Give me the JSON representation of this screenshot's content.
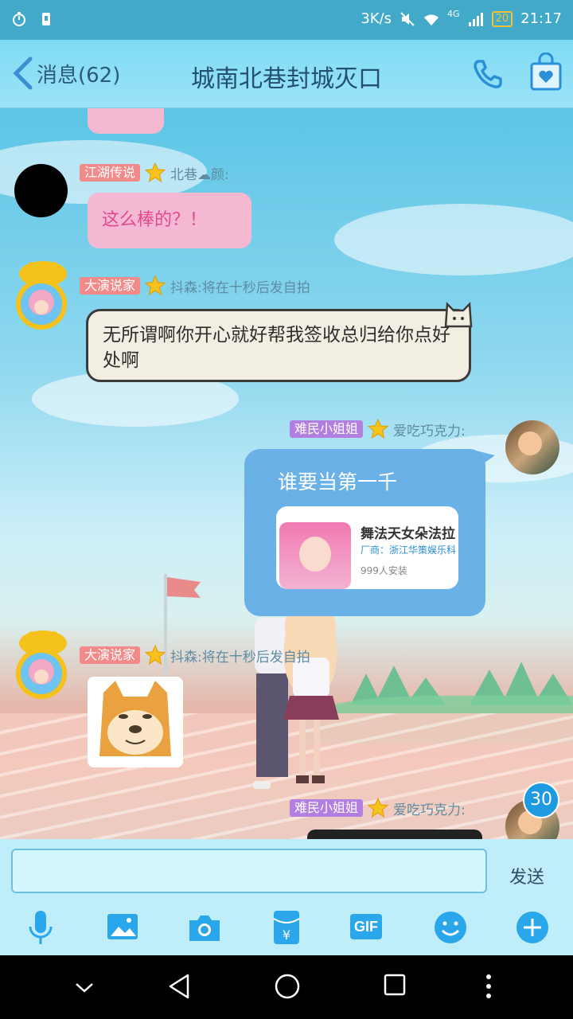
{
  "status_bar": {
    "speed": "3K/s",
    "network": "4G",
    "battery": "20",
    "time": "21:17"
  },
  "header": {
    "back_label": "消息(62)",
    "title": "城南北巷封城灭口"
  },
  "messages": [
    {
      "badge": "江湖传说",
      "badge_color": "#f28a8a",
      "sender": "北巷☁颜:",
      "text": "这么棒的？！"
    },
    {
      "badge": "大演说家",
      "badge_color": "#f28a8a",
      "sender": "抖森:将在十秒后发自拍",
      "text": "无所谓啊你开心就好帮我签收总归给你点好处啊"
    },
    {
      "badge": "难民小姐姐",
      "badge_color": "#b27fe0",
      "sender": "爱吃巧克力:",
      "text": "谁要当第一千",
      "card": {
        "title": "舞法天女朵法拉",
        "vendor": "厂商：浙江华策娱乐科",
        "installs": "999人安装"
      }
    },
    {
      "badge": "大演说家",
      "badge_color": "#f28a8a",
      "sender": "抖森:将在十秒后发自拍"
    },
    {
      "badge": "难民小姐姐",
      "badge_color": "#b27fe0",
      "sender": "爱吃巧克力:"
    }
  ],
  "unread_count": "30",
  "input": {
    "placeholder": "",
    "send_label": "发送"
  },
  "toolbar": [
    "mic-icon",
    "image-icon",
    "camera-icon",
    "red-packet-icon",
    "gif-icon",
    "emoji-icon",
    "plus-icon"
  ],
  "gif_label": "GIF",
  "colors": {
    "header": "#8fdff5",
    "blue_bubble": "#6ab1e8",
    "pink_bubble": "#f4b8d2",
    "accent": "#1e90d6"
  }
}
